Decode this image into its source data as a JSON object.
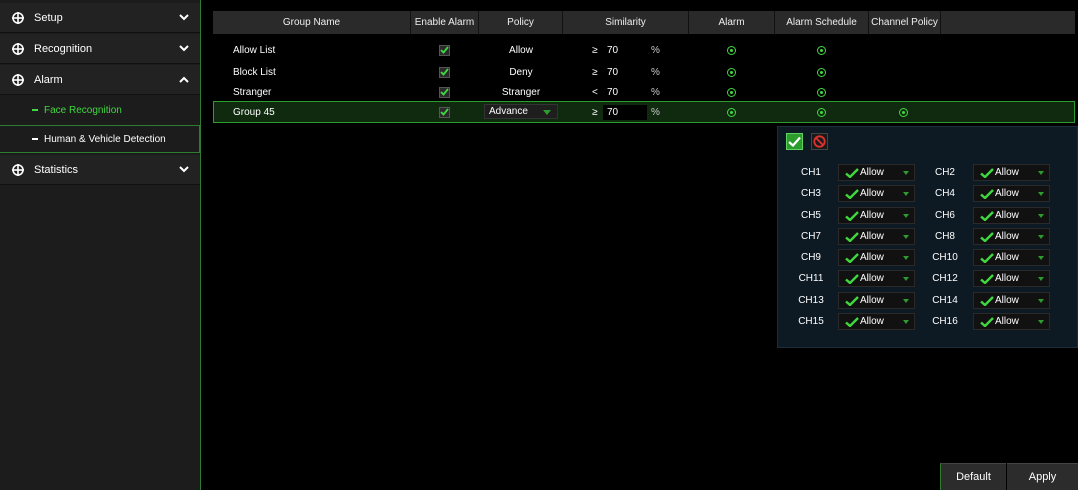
{
  "sidebar": {
    "setup": "Setup",
    "recognition": "Recognition",
    "alarm": "Alarm",
    "face_recognition": "Face Recognition",
    "human_vehicle": "Human & Vehicle Detection",
    "statistics": "Statistics"
  },
  "table": {
    "headers": [
      "Group Name",
      "Enable Alarm",
      "Policy",
      "Similarity",
      "Alarm",
      "Alarm Schedule",
      "Channel Policy"
    ],
    "rows": [
      {
        "name": "Allow List",
        "policy": "Allow",
        "op": "≥",
        "similarity": "70",
        "pct": "%"
      },
      {
        "name": "Block List",
        "policy": "Deny",
        "op": "≥",
        "similarity": "70",
        "pct": "%"
      },
      {
        "name": "Stranger",
        "policy": "Stranger",
        "op": "<",
        "similarity": "70",
        "pct": "%"
      },
      {
        "name": "Group 45",
        "policy": "Advance",
        "op": "≥",
        "similarity": "70",
        "pct": "%"
      }
    ]
  },
  "channels": [
    {
      "name": "CH1",
      "value": "Allow"
    },
    {
      "name": "CH2",
      "value": "Allow"
    },
    {
      "name": "CH3",
      "value": "Allow"
    },
    {
      "name": "CH4",
      "value": "Allow"
    },
    {
      "name": "CH5",
      "value": "Allow"
    },
    {
      "name": "CH6",
      "value": "Allow"
    },
    {
      "name": "CH7",
      "value": "Allow"
    },
    {
      "name": "CH8",
      "value": "Allow"
    },
    {
      "name": "CH9",
      "value": "Allow"
    },
    {
      "name": "CH10",
      "value": "Allow"
    },
    {
      "name": "CH11",
      "value": "Allow"
    },
    {
      "name": "CH12",
      "value": "Allow"
    },
    {
      "name": "CH13",
      "value": "Allow"
    },
    {
      "name": "CH14",
      "value": "Allow"
    },
    {
      "name": "CH15",
      "value": "Allow"
    },
    {
      "name": "CH16",
      "value": "Allow"
    }
  ],
  "buttons": {
    "default": "Default",
    "apply": "Apply"
  },
  "colors": {
    "accent": "#3fd93f",
    "border_green": "#2e7d2e",
    "panel_bg": "#0d1a24",
    "deny_red": "#e03030"
  }
}
